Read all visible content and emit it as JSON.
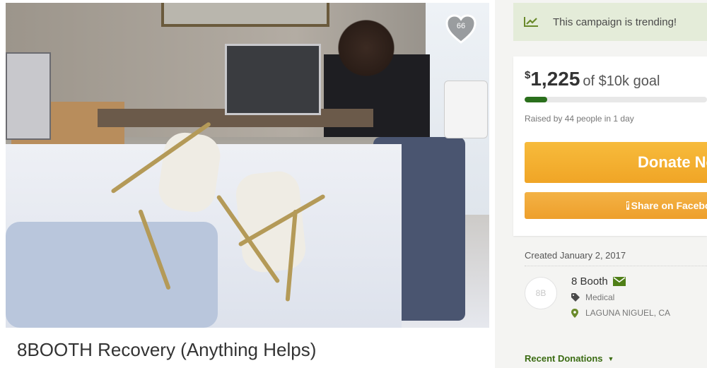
{
  "campaign": {
    "title": "8BOOTH Recovery (Anything Helps)",
    "heart_count": "66"
  },
  "trending": {
    "text": "This campaign is trending!",
    "icon": "trending-chart-icon"
  },
  "funding": {
    "currency_symbol": "$",
    "amount": "1,225",
    "goal_text": "of $10k goal",
    "progress_fraction": 0.1225,
    "raised_text": "Raised by 44 people in 1 day"
  },
  "buttons": {
    "donate_label": "Donate Now",
    "share_label": "Share on Facebook",
    "share_icon": "facebook-icon"
  },
  "organizer": {
    "created": "Created January 2, 2017",
    "avatar_initials": "8B",
    "name": "8 Booth",
    "category": "Medical",
    "location": "LAGUNA NIGUEL, CA"
  },
  "recent": {
    "label": "Recent Donations"
  },
  "colors": {
    "accent_green": "#2a6f1c",
    "donate_orange": "#f0a526",
    "trending_bg": "#e4ecd9"
  }
}
